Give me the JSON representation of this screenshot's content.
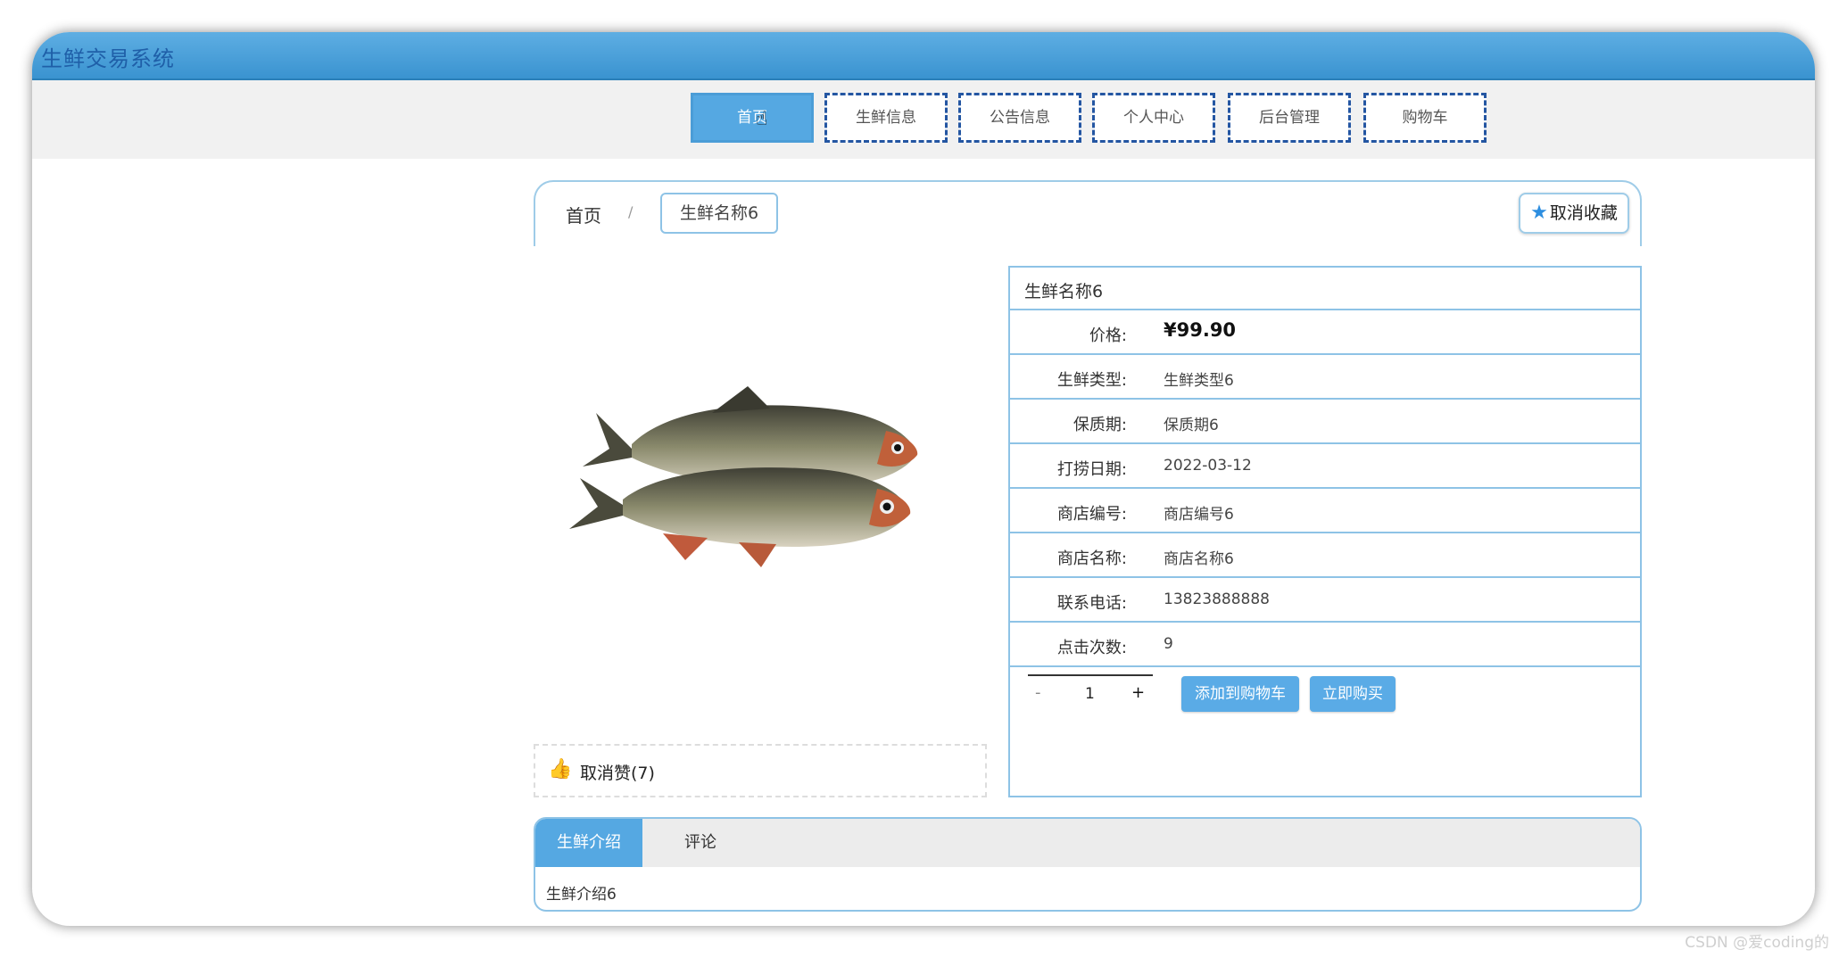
{
  "app": {
    "title": "生鲜交易系统"
  },
  "nav": {
    "items": [
      {
        "label": "首页",
        "active": true
      },
      {
        "label": "生鲜信息",
        "active": false
      },
      {
        "label": "公告信息",
        "active": false
      },
      {
        "label": "个人中心",
        "active": false
      },
      {
        "label": "后台管理",
        "active": false
      },
      {
        "label": "购物车",
        "active": false
      }
    ]
  },
  "breadcrumb": {
    "home": "首页",
    "separator": "/",
    "current": "生鲜名称6"
  },
  "favorite": {
    "label": "取消收藏",
    "icon": "star-icon"
  },
  "product": {
    "name": "生鲜名称6",
    "image_icon": "fish-image",
    "fields": [
      {
        "label": "价格:",
        "value": "¥99.90"
      },
      {
        "label": "生鲜类型:",
        "value": "生鲜类型6"
      },
      {
        "label": "保质期:",
        "value": "保质期6"
      },
      {
        "label": "打捞日期:",
        "value": "2022-03-12"
      },
      {
        "label": "商店编号:",
        "value": "商店编号6"
      },
      {
        "label": "商店名称:",
        "value": "商店名称6"
      },
      {
        "label": "联系电话:",
        "value": "13823888888"
      },
      {
        "label": "点击次数:",
        "value": "9"
      }
    ],
    "quantity": {
      "minus": "-",
      "value": "1",
      "plus": "+"
    },
    "add_to_cart": "添加到购物车",
    "buy_now": "立即购买",
    "like": {
      "label": "取消赞(7)",
      "icon": "thumbs-up-icon"
    }
  },
  "tabs": {
    "items": [
      {
        "label": "生鲜介绍"
      },
      {
        "label": "评论"
      }
    ],
    "content": "生鲜介绍6"
  },
  "watermark": "CSDN @爱coding的"
}
